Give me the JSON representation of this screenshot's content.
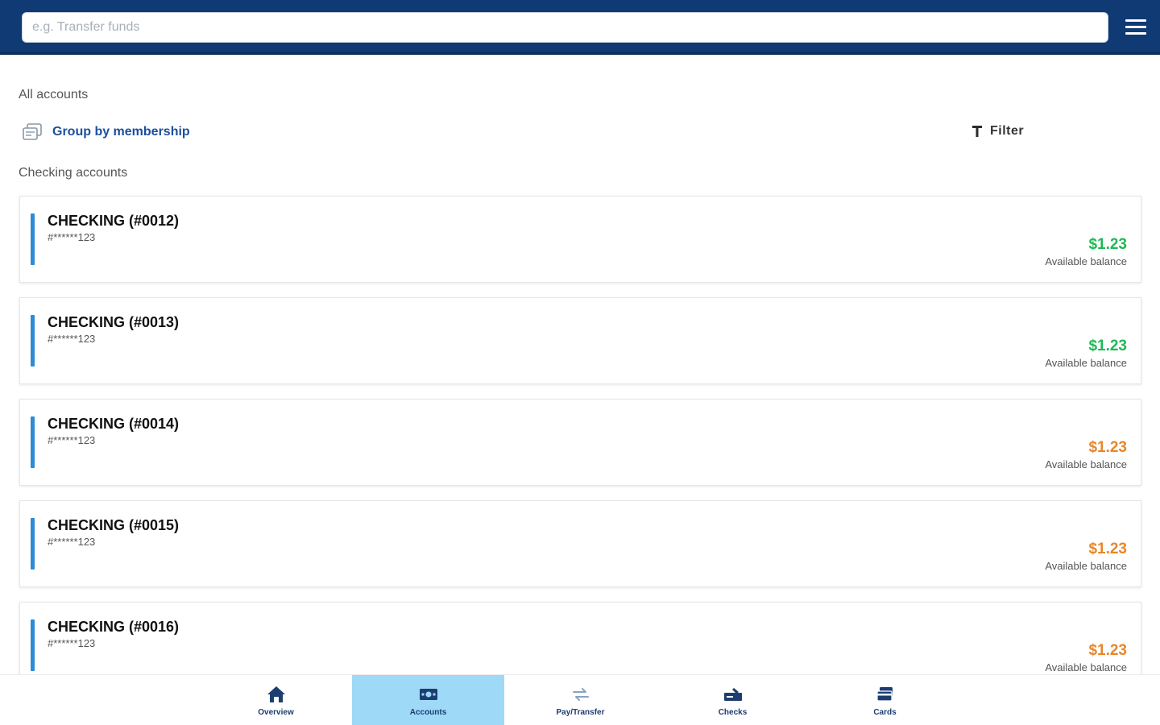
{
  "search": {
    "placeholder": "e.g. Transfer funds"
  },
  "header": {
    "all_accounts": "All accounts",
    "group_by": "Group by membership",
    "filter": "Filter",
    "section_checking": "Checking accounts"
  },
  "colors": {
    "positive": "#1db954",
    "warning": "#e8862a",
    "accent": "#2e8bd6",
    "brand": "#0f3a73",
    "nav_active": "#9ed9f7"
  },
  "accounts": [
    {
      "name": "CHECKING (#0012)",
      "mask": "#******123",
      "amount": "$1.23",
      "balance_label": "Available balance",
      "status": "positive"
    },
    {
      "name": "CHECKING (#0013)",
      "mask": "#******123",
      "amount": "$1.23",
      "balance_label": "Available balance",
      "status": "positive"
    },
    {
      "name": "CHECKING (#0014)",
      "mask": "#******123",
      "amount": "$1.23",
      "balance_label": "Available balance",
      "status": "warning"
    },
    {
      "name": "CHECKING (#0015)",
      "mask": "#******123",
      "amount": "$1.23",
      "balance_label": "Available balance",
      "status": "warning"
    },
    {
      "name": "CHECKING (#0016)",
      "mask": "#******123",
      "amount": "$1.23",
      "balance_label": "Available balance",
      "status": "warning"
    }
  ],
  "nav": [
    {
      "label": "Overview",
      "icon": "home-icon",
      "active": false
    },
    {
      "label": "Accounts",
      "icon": "accounts-icon",
      "active": true
    },
    {
      "label": "Pay/Transfer",
      "icon": "transfer-icon",
      "active": false
    },
    {
      "label": "Checks",
      "icon": "checks-icon",
      "active": false
    },
    {
      "label": "Cards",
      "icon": "cards-icon",
      "active": false
    }
  ]
}
